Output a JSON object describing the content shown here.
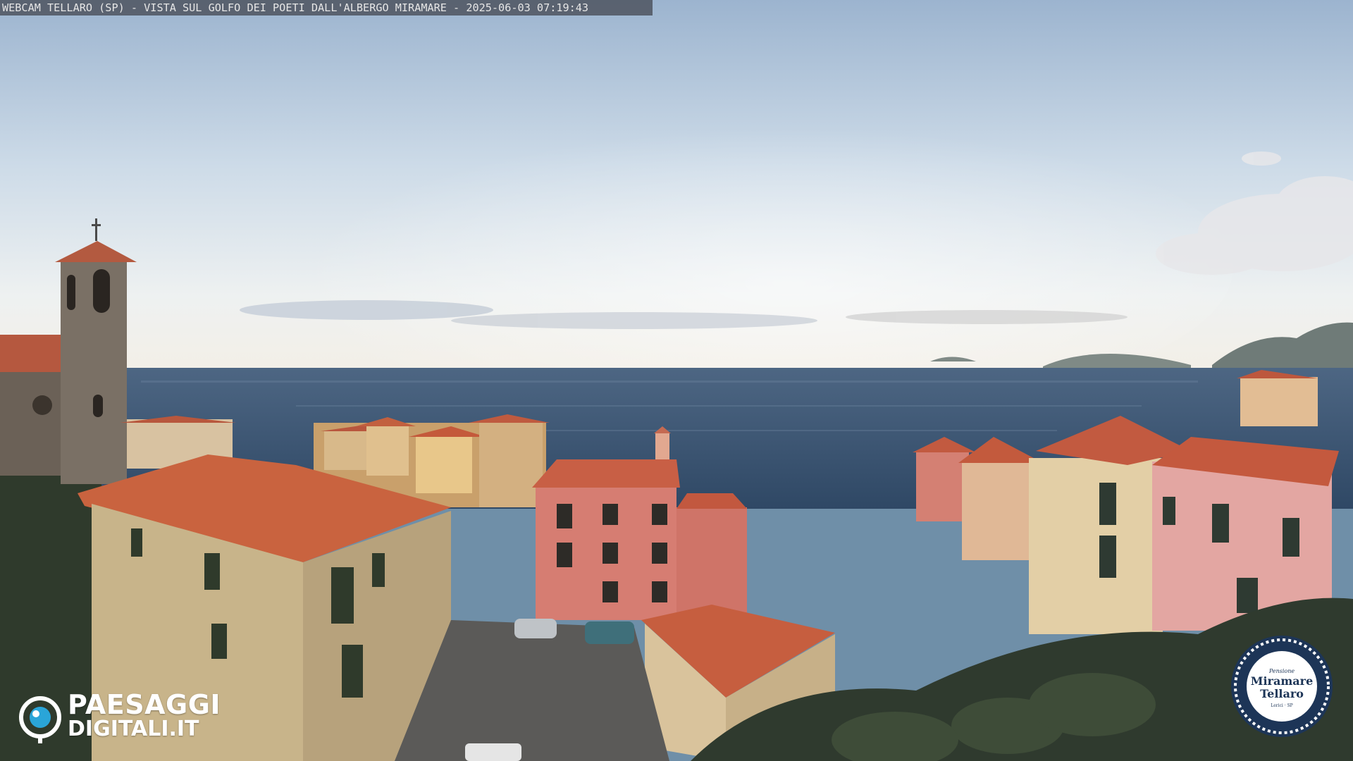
{
  "overlay": {
    "caption": "WEBCAM TELLARO (SP) - VISTA SUL GOLFO DEI POETI DALL'ALBERGO MIRAMARE - 2025-06-03 07:19:43"
  },
  "branding": {
    "logo_line1": "PAESAGGI",
    "logo_line2": "DIGITALI",
    "logo_tld": ".IT",
    "badge_top": "Pensione",
    "badge_name_1": "Miramare",
    "badge_name_2": "Tellaro",
    "badge_sub": "Lerici · SP"
  },
  "icons": {
    "logo": "eye-icon",
    "badge": "hotel-seal-icon"
  },
  "colors": {
    "sky": "#d9e4ee",
    "sea": "#3f5a78",
    "roof": "#c85f45",
    "badge_navy": "#1d3557"
  }
}
